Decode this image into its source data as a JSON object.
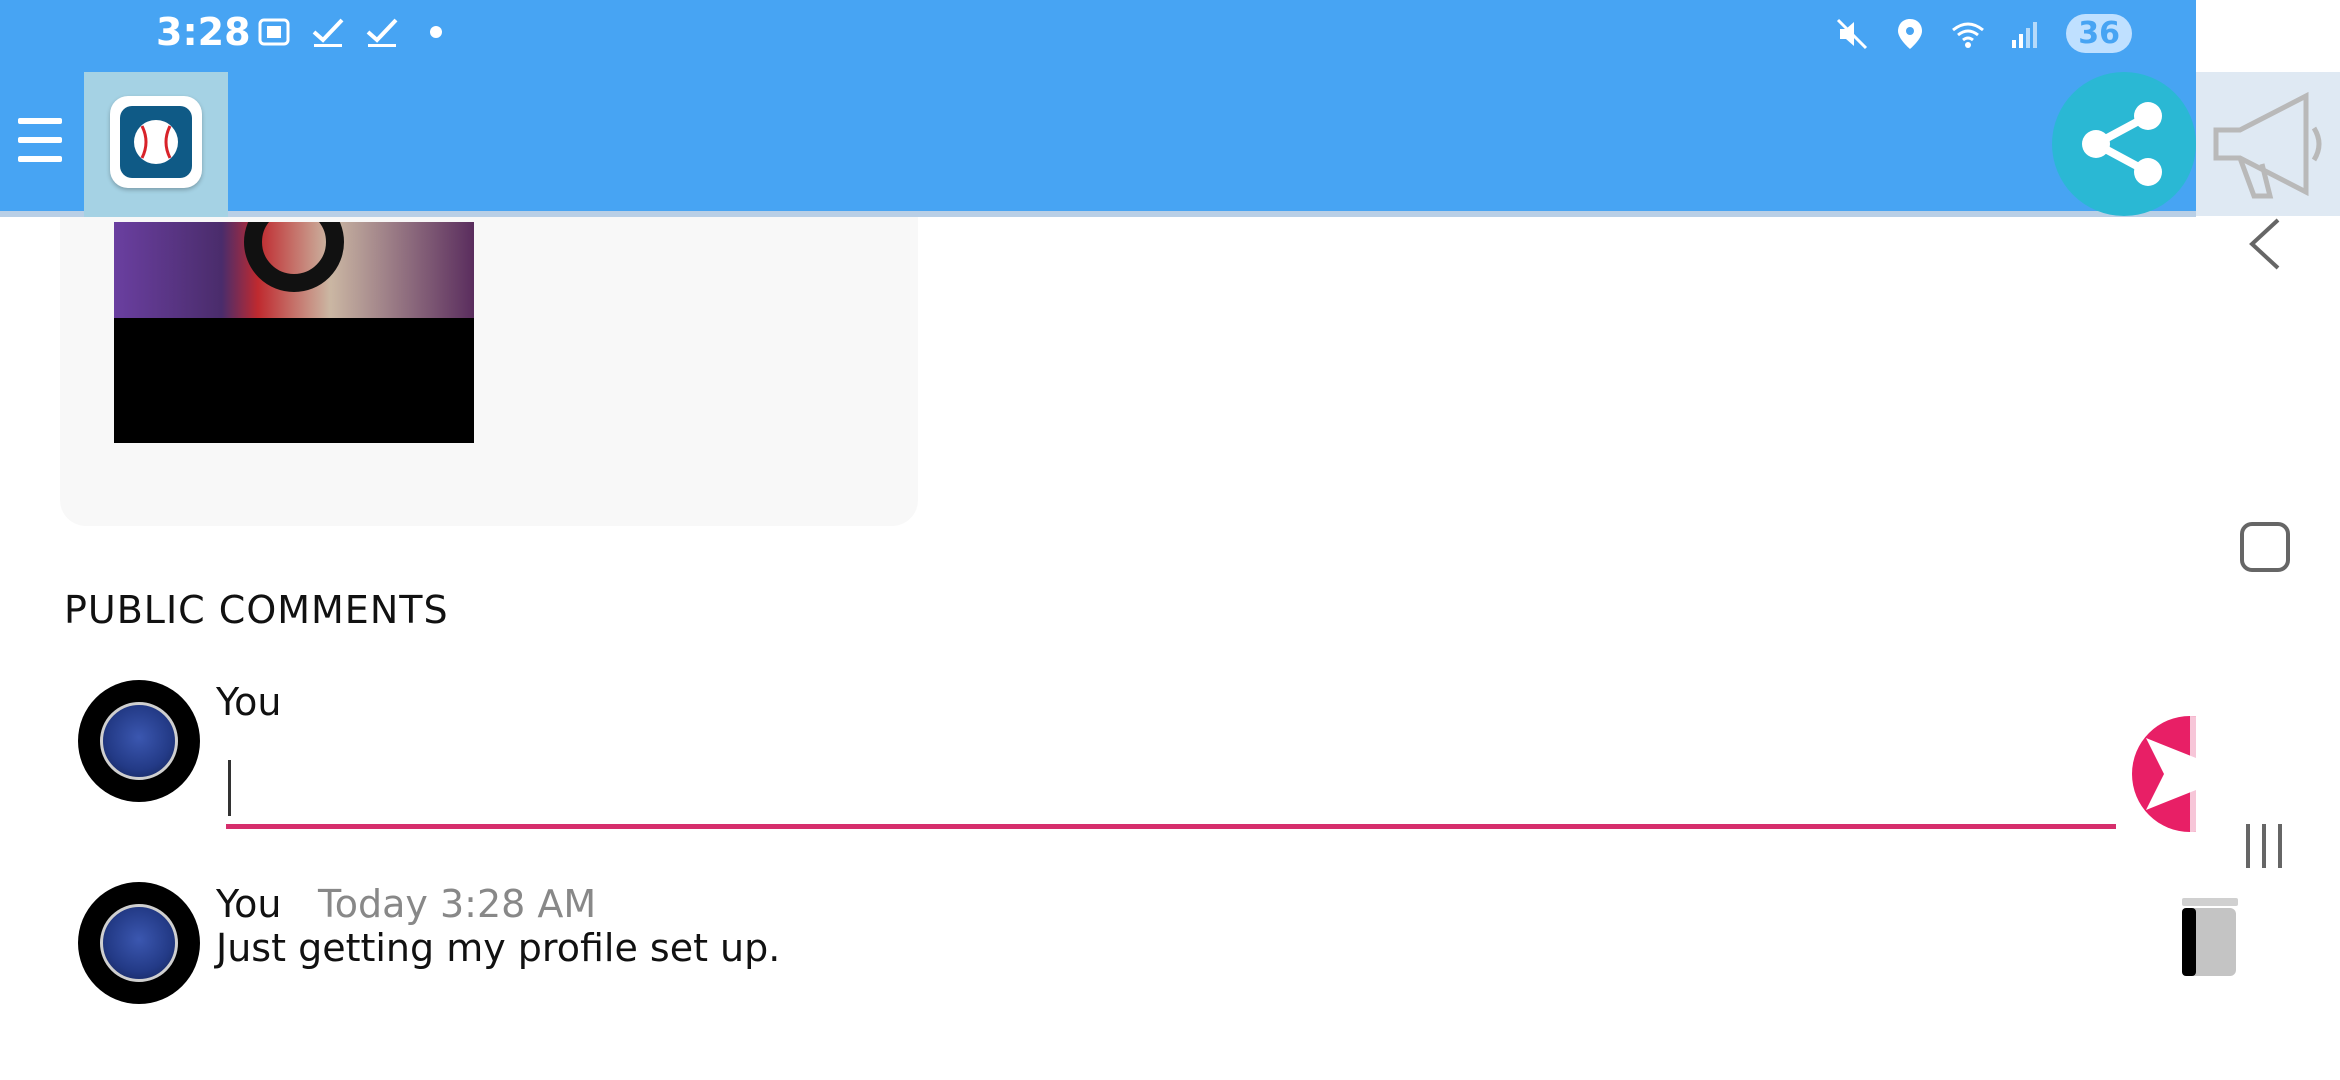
{
  "status_bar": {
    "time": "3:28",
    "battery": "36",
    "left_icons": [
      "screenshot-icon",
      "check-icon",
      "check-icon",
      "dot-icon"
    ],
    "right_icons": [
      "mute-icon",
      "location-icon",
      "wifi-icon",
      "signal-icon"
    ]
  },
  "header": {
    "menu_icon": "hamburger-icon",
    "app_icon": "baseball-app-icon",
    "share_icon": "share-icon"
  },
  "section": {
    "title": "PUBLIC COMMENTS"
  },
  "composer": {
    "author": "You",
    "input_value": "",
    "send_icon": "send-icon"
  },
  "comments": [
    {
      "author": "You",
      "timestamp": "Today 3:28 AM",
      "text": "Just getting my profile set up.",
      "delete_icon": "trash-icon"
    }
  ],
  "colors": {
    "header_blue": "#47a4f3",
    "accent_pink": "#d62e6c",
    "share_teal": "#2ab8d4"
  }
}
